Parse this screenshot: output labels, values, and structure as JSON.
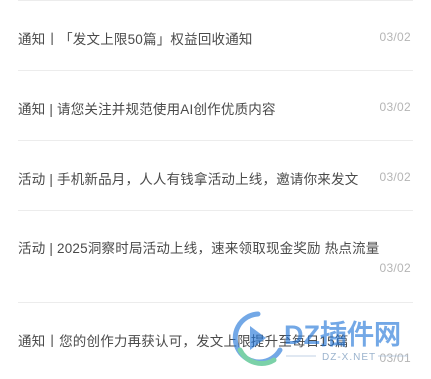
{
  "notices": [
    {
      "title": "通知丨「发文上限50篇」权益回收通知",
      "date": "03/02"
    },
    {
      "title": "通知 | 请您关注并规范使用AI创作优质内容",
      "date": "03/02"
    },
    {
      "title": "活动 | 手机新品月，人人有钱拿活动上线，邀请你来发文",
      "date": "03/02"
    },
    {
      "title": "活动 | 2025洞察时局活动上线，速来领取现金奖励 热点流量",
      "date": "03/02"
    },
    {
      "title": "通知丨您的创作力再获认可，发文上限提升至每日15篇",
      "date": "03/01"
    }
  ],
  "watermark": {
    "brand": "DZ插件网",
    "url": "DZ-X.NET"
  },
  "colors": {
    "title_text": "#4a4a4a",
    "date_text": "#b5b5b5",
    "divider": "#ececec",
    "watermark_blue": "#1e73d8",
    "watermark_green": "#2bb673"
  }
}
